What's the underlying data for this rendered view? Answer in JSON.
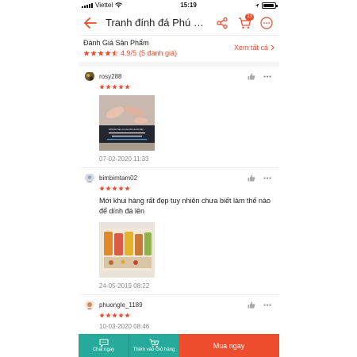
{
  "status": {
    "carrier": "Viettel",
    "time": "15:19",
    "battery_level": 0.95
  },
  "nav": {
    "title": "Tranh đính đá Phú qu...",
    "cart_badge": "13",
    "icons": [
      "back-arrow-icon",
      "share-icon",
      "cart-icon",
      "more-icon"
    ]
  },
  "rating": {
    "title": "Đánh Giá Sản Phẩm",
    "score": "4.9/5",
    "count_text": "(5 đánh giá)",
    "see_all": "Xem tất cả",
    "stars_value": 4.5
  },
  "reviews": [
    {
      "user": "rosy288",
      "stars": 5,
      "comment": "",
      "photo_caption": "Mới khi hạn có các thứ dưới đây...",
      "date": "07-02-2020 11:33"
    },
    {
      "user": "bimbimtam02",
      "stars": 5,
      "comment": "Mới khui hàng rất đẹp tuy nhiên chưa biết làm thế nào để dính đá lên",
      "date": "24-05-2019 08:22"
    },
    {
      "user": "phuongle_1189",
      "stars": 5,
      "comment": "",
      "date": "10-03-2020 08:46"
    }
  ],
  "bottom": {
    "chat": "Chat ngay",
    "add_cart": "Thêm vào Giỏ hàng",
    "buy": "Mua ngay"
  },
  "colors": {
    "accent": "#ee4d2d",
    "teal": "#26aa99",
    "star": "#ee4d2d"
  }
}
